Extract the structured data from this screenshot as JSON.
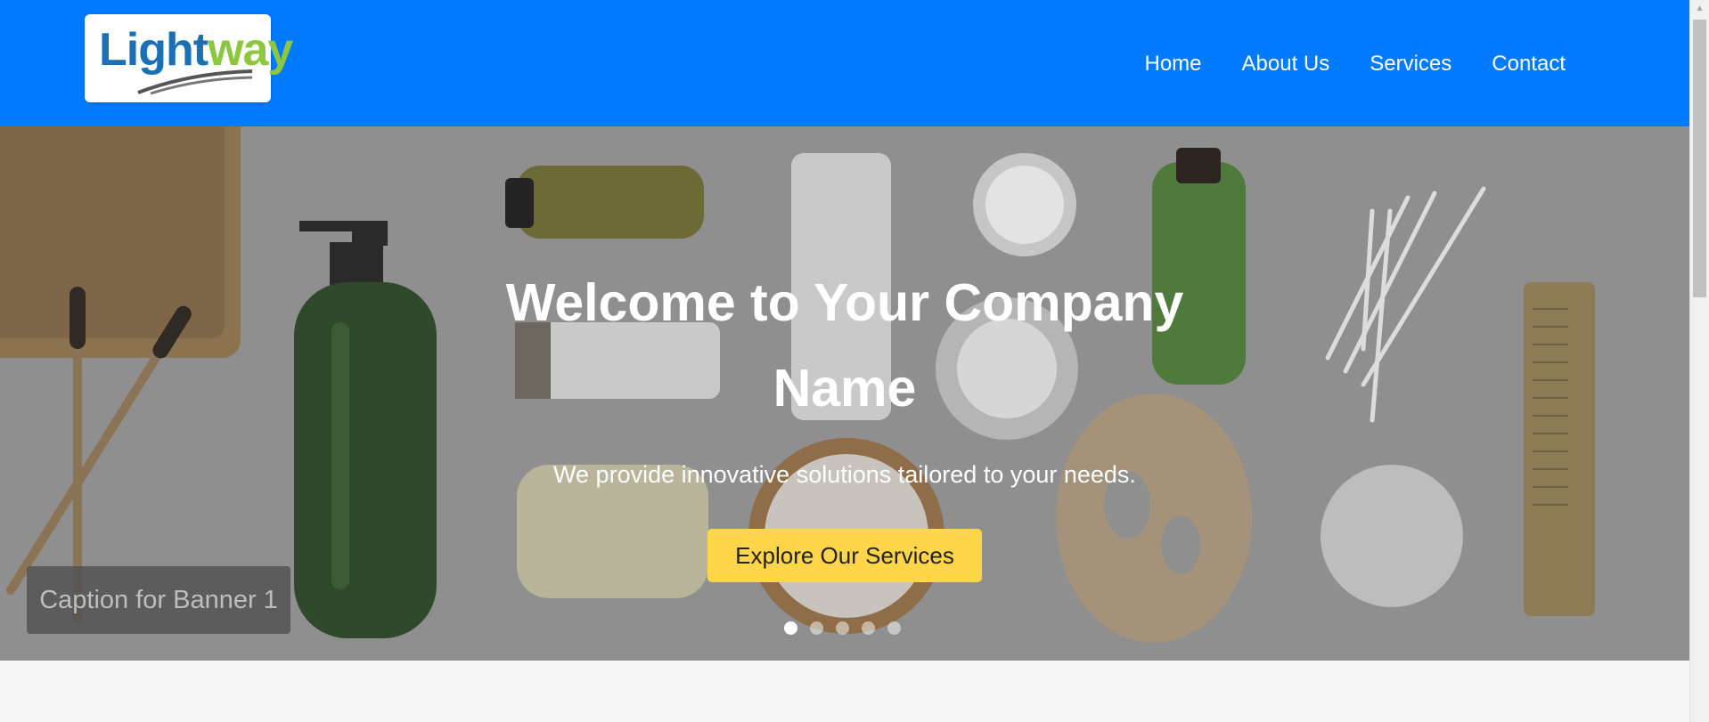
{
  "brand": {
    "logo_part1": "Light",
    "logo_part2": "way"
  },
  "nav": {
    "items": [
      "Home",
      "About Us",
      "Services",
      "Contact"
    ]
  },
  "hero": {
    "title_line1": "Welcome to Your Company",
    "title_line2": "Name",
    "subtitle": "We provide innovative solutions tailored to your needs.",
    "cta_label": "Explore Our Services",
    "caption": "Caption for Banner 1",
    "active_slide": 1,
    "slide_count": 5
  },
  "colors": {
    "header": "#007bff",
    "cta": "#ffd64a",
    "logo_blue": "#1a6fb5",
    "logo_green": "#8dc63f"
  }
}
